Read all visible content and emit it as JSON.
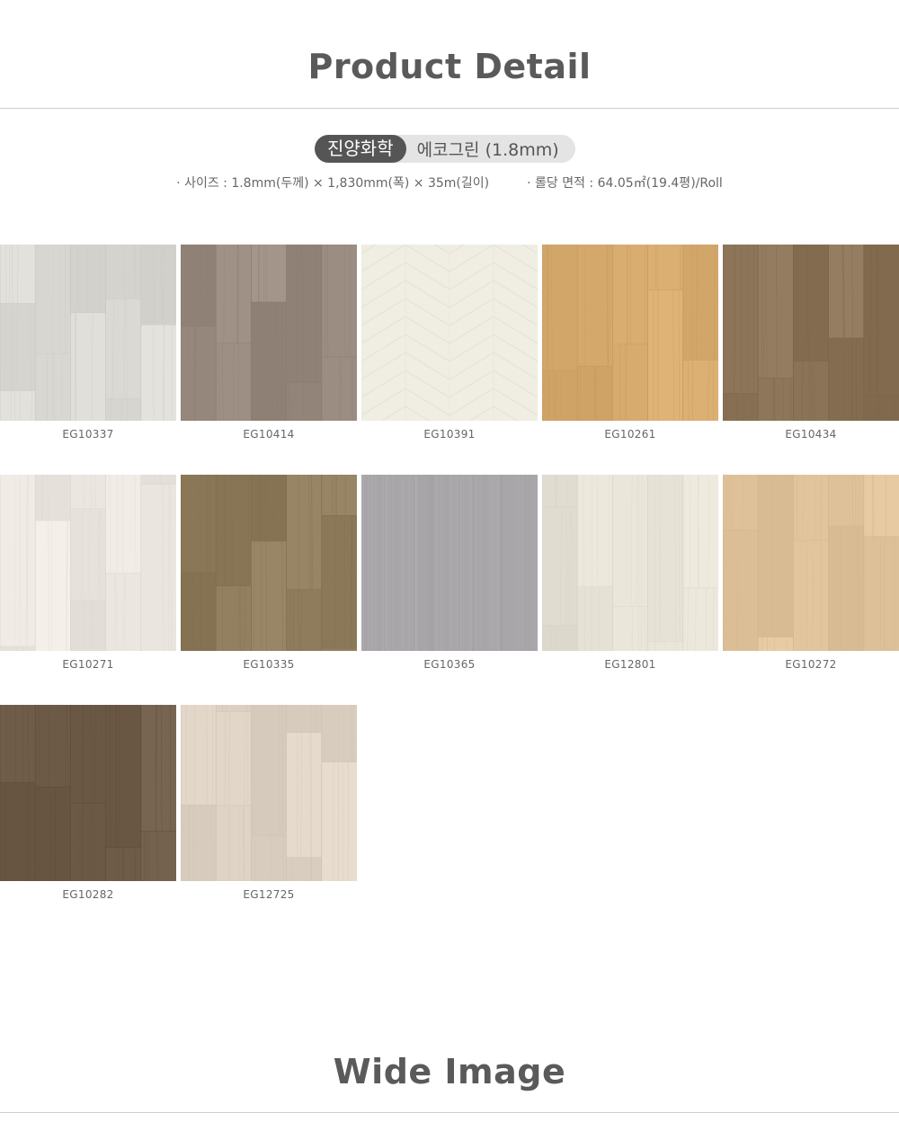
{
  "sections": {
    "product_detail_title": "Product Detail",
    "wide_image_title": "Wide Image"
  },
  "brand": {
    "maker": "진양화학",
    "product": "에코그린 (1.8mm)"
  },
  "specs": {
    "size": "· 사이즈 : 1.8mm(두께) × 1,830mm(폭) × 35m(길이)",
    "area": "· 롤당 면적 : 64.05㎡(19.4평)/Roll"
  },
  "products": [
    {
      "code": "EG10337",
      "color": "#d9d8d2",
      "pattern": "plank"
    },
    {
      "code": "EG10414",
      "color": "#9a8b80",
      "pattern": "plank"
    },
    {
      "code": "EG10391",
      "color": "#f0ede3",
      "pattern": "herringbone"
    },
    {
      "code": "EG10261",
      "color": "#d4a76b",
      "pattern": "plank"
    },
    {
      "code": "EG10434",
      "color": "#8b7457",
      "pattern": "plank"
    },
    {
      "code": "EG10271",
      "color": "#ebe6df",
      "pattern": "plank"
    },
    {
      "code": "EG10335",
      "color": "#8f7c5d",
      "pattern": "plank"
    },
    {
      "code": "EG10365",
      "color": "#a9a6aa",
      "pattern": "fabric"
    },
    {
      "code": "EG12801",
      "color": "#e6e2d6",
      "pattern": "plank"
    },
    {
      "code": "EG10272",
      "color": "#e2c49c",
      "pattern": "plank"
    },
    {
      "code": "EG10282",
      "color": "#6f5c48",
      "pattern": "plank"
    },
    {
      "code": "EG12725",
      "color": "#ddd2c4",
      "pattern": "plank"
    }
  ]
}
